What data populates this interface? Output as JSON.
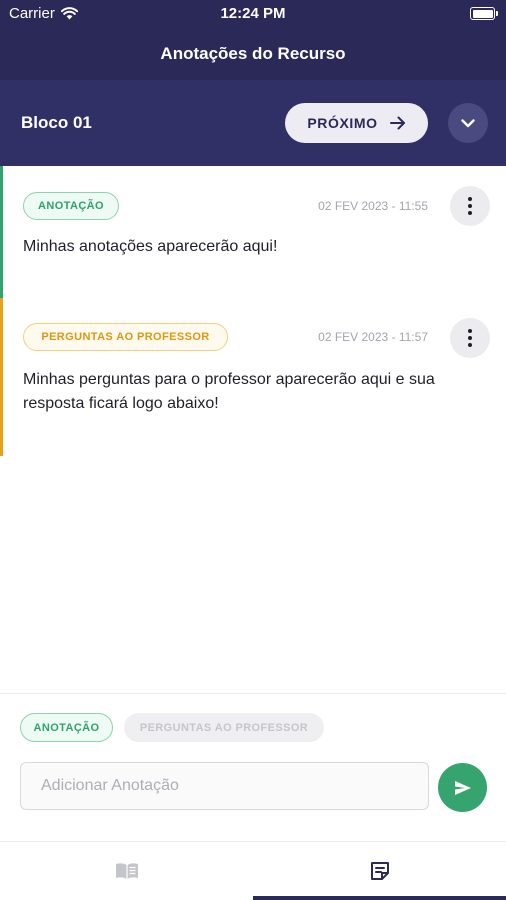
{
  "status_bar": {
    "carrier": "Carrier",
    "time": "12:24 PM"
  },
  "header": {
    "title": "Anotações do Recurso"
  },
  "block": {
    "title": "Bloco 01",
    "next_label": "PRÓXIMO"
  },
  "notes": [
    {
      "tag": "ANOTAÇÃO",
      "tag_color": "#2ea36b",
      "date": "02 FEV 2023 - 11:55",
      "text": "Minhas anotações aparecerão aqui!"
    },
    {
      "tag": "PERGUNTAS AO PROFESSOR",
      "tag_color": "#e0960d",
      "date": "02 FEV 2023 - 11:57",
      "text": "Minhas perguntas para o professor aparecerão aqui e sua resposta ficará logo abaixo!"
    }
  ],
  "composer": {
    "chips": [
      {
        "label": "ANOTAÇÃO",
        "selected": true
      },
      {
        "label": "PERGUNTAS AO PROFESSOR",
        "selected": false
      }
    ],
    "input_placeholder": "Adicionar Anotação",
    "input_value": ""
  },
  "tabs": [
    {
      "icon": "book-icon",
      "selected": false
    },
    {
      "icon": "notes-icon",
      "selected": true
    }
  ],
  "colors": {
    "header_bg": "#2a2957",
    "block_bg": "#302f66",
    "accent_green": "#35a46f",
    "accent_yellow": "#e7a21b"
  }
}
